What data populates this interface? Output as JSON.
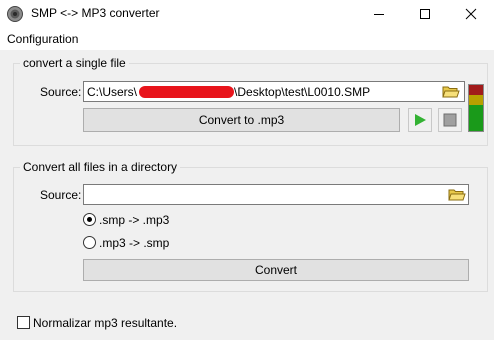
{
  "window": {
    "title": "SMP <-> MP3 converter"
  },
  "menu": {
    "items": [
      "Configuration"
    ]
  },
  "single_file": {
    "legend": "convert a single file",
    "source_label": "Source:",
    "source_value_prefix": "C:\\Users\\",
    "source_value_suffix": "\\Desktop\\test\\L0010.SMP",
    "convert_button": "Convert to .mp3"
  },
  "directory": {
    "legend": "Convert all files in a directory",
    "source_label": "Source:",
    "source_value": "",
    "option_smp_to_mp3": ".smp -> .mp3",
    "option_mp3_to_smp": ".mp3 -> .smp",
    "selected_option": "smp_to_mp3",
    "convert_button": "Convert"
  },
  "normalize": {
    "label": "Normalizar mp3 resultante.",
    "checked": false
  },
  "colors": {
    "play_green": "#33b233",
    "vu_red": "#a11a1a",
    "vu_yellow": "#b8a000",
    "vu_green": "#1a9a1a",
    "redaction": "#e8141b"
  },
  "icons": {
    "app": "speaker-icon",
    "folder": "folder-open-icon",
    "play": "play-icon",
    "stop": "stop-icon"
  }
}
